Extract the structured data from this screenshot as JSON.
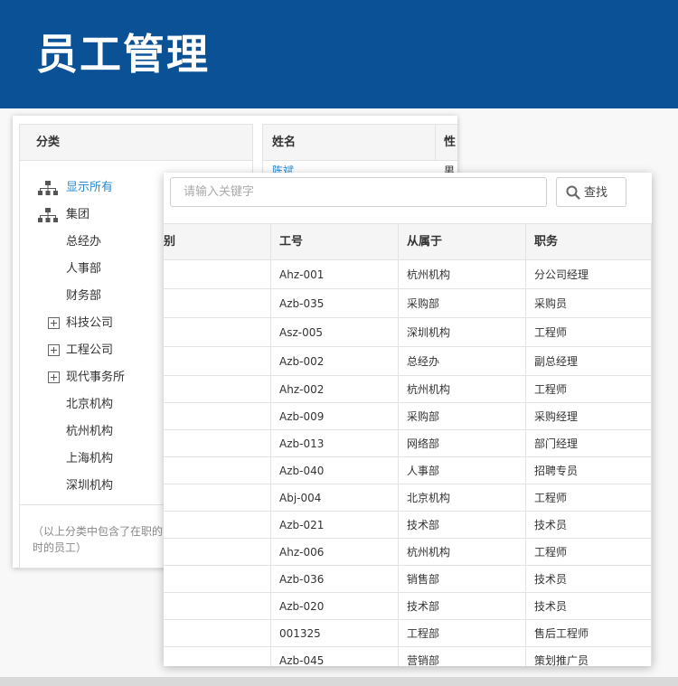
{
  "header": {
    "title": "员工管理"
  },
  "category_panel": {
    "title": "分类",
    "items": [
      {
        "label": "显示所有",
        "icon": "org-chart-icon",
        "active": true,
        "indent": 0
      },
      {
        "label": "集团",
        "icon": "org-chart-icon",
        "active": false,
        "indent": 0
      },
      {
        "label": "总经办",
        "icon": "",
        "active": false,
        "indent": 1
      },
      {
        "label": "人事部",
        "icon": "",
        "active": false,
        "indent": 1
      },
      {
        "label": "财务部",
        "icon": "",
        "active": false,
        "indent": 1
      },
      {
        "label": "科技公司",
        "icon": "expand-plus-icon",
        "active": false,
        "indent": 1
      },
      {
        "label": "工程公司",
        "icon": "expand-plus-icon",
        "active": false,
        "indent": 1
      },
      {
        "label": "现代事务所",
        "icon": "expand-plus-icon",
        "active": false,
        "indent": 1
      },
      {
        "label": "北京机构",
        "icon": "",
        "active": false,
        "indent": 1
      },
      {
        "label": "杭州机构",
        "icon": "",
        "active": false,
        "indent": 1
      },
      {
        "label": "上海机构",
        "icon": "",
        "active": false,
        "indent": 1
      },
      {
        "label": "深圳机构",
        "icon": "",
        "active": false,
        "indent": 1
      }
    ],
    "note_line1": "（以上分类中包含了在职的",
    "note_line2": "时的员工）"
  },
  "back_table": {
    "columns": [
      "姓名",
      "性"
    ],
    "first_row": [
      "陈斌",
      "男"
    ]
  },
  "search": {
    "placeholder": "请输入关键字",
    "button_label": "查找"
  },
  "employee_table": {
    "columns": [
      "别",
      "工号",
      "从属于",
      "职务"
    ],
    "rows": [
      [
        "",
        "Ahz-001",
        "杭州机构",
        "分公司经理"
      ],
      [
        "",
        "Azb-035",
        "采购部",
        "采购员"
      ],
      [
        "",
        "Asz-005",
        "深圳机构",
        "工程师"
      ],
      [
        "",
        "Azb-002",
        "总经办",
        "副总经理"
      ],
      [
        "",
        "Ahz-002",
        "杭州机构",
        "工程师"
      ],
      [
        "",
        "Azb-009",
        "采购部",
        "采购经理"
      ],
      [
        "",
        "Azb-013",
        "网络部",
        "部门经理"
      ],
      [
        "",
        "Azb-040",
        "人事部",
        "招聘专员"
      ],
      [
        "",
        "Abj-004",
        "北京机构",
        "工程师"
      ],
      [
        "",
        "Azb-021",
        "技术部",
        "技术员"
      ],
      [
        "",
        "Ahz-006",
        "杭州机构",
        "工程师"
      ],
      [
        "",
        "Azb-036",
        "销售部",
        "技术员"
      ],
      [
        "",
        "Azb-020",
        "技术部",
        "技术员"
      ],
      [
        "",
        "001325",
        "工程部",
        "售后工程师"
      ],
      [
        "",
        "Azb-045",
        "营销部",
        "策划推广员"
      ]
    ]
  },
  "colors": {
    "header_bg": "#0b5196",
    "link": "#2a8bd0",
    "border": "#e3e3e3"
  }
}
